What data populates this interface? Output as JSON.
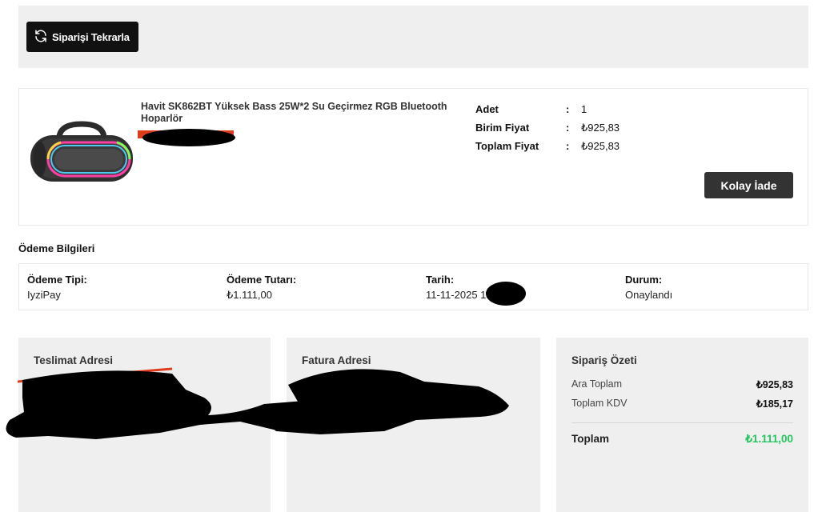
{
  "toolbar": {
    "reorder_label": "Siparişi Tekrarla"
  },
  "product": {
    "name": "Havit SK862BT Yüksek Bass 25W*2 Su Geçirmez RGB Bluetooth Hoparlör",
    "labels": {
      "qty": "Adet",
      "unit_price": "Birim Fiyat",
      "total_price": "Toplam Fiyat"
    },
    "colon": ":",
    "values": {
      "qty": "1",
      "unit_price": "₺925,83",
      "total_price": "₺925,83"
    },
    "return_label": "Kolay İade"
  },
  "payment": {
    "title": "Ödeme Bilgileri",
    "type_label": "Ödeme Tipi:",
    "type_value": "IyziPay",
    "amount_label": "Ödeme Tutarı:",
    "amount_value": "₺1.111,00",
    "date_label": "Tarih:",
    "date_value": "11-11-2025 18",
    "status_label": "Durum:",
    "status_value": "Onaylandı"
  },
  "delivery": {
    "title": "Teslimat Adresi"
  },
  "billing": {
    "title": "Fatura Adresi"
  },
  "summary": {
    "title": "Sipariş Özeti",
    "subtotal_label": "Ara Toplam",
    "subtotal_value": "₺925,83",
    "vat_label": "Toplam KDV",
    "vat_value": "₺185,17",
    "total_label": "Toplam",
    "total_value": "₺1.111,00"
  },
  "colors": {
    "accent_green": "#22c55e",
    "button_dark": "#111111",
    "panel_bg": "#efefef"
  },
  "icons": {
    "reorder": "refresh-icon"
  }
}
